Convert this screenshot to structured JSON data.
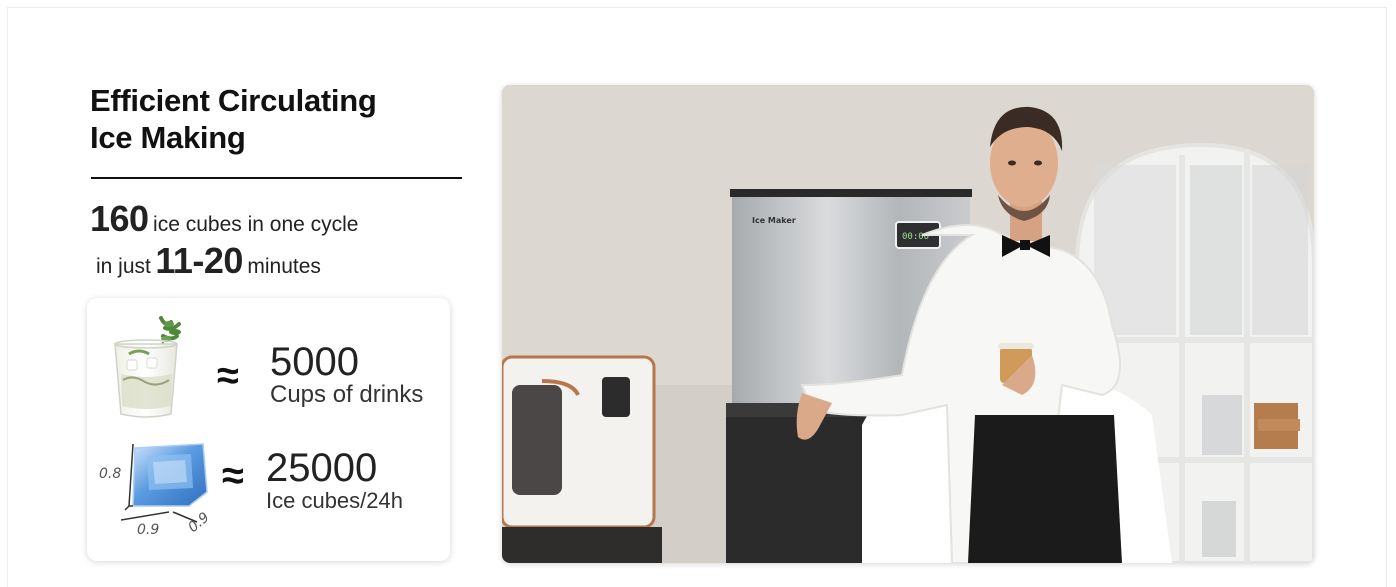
{
  "heading": {
    "line1": "Efficient Circulating",
    "line2": "Ice Making"
  },
  "stats": {
    "cubes_count": "160",
    "cubes_text": "ice cubes in one cycle",
    "in_just": "in just",
    "minutes_value": "11-20",
    "minutes_text": "minutes"
  },
  "card": {
    "drinks": {
      "approx": "≈",
      "value": "5000",
      "unit": "Cups of drinks",
      "icon": "cocktail-glass-icon"
    },
    "ice": {
      "approx": "≈",
      "value": "25000",
      "unit": "Ice cubes/24h",
      "icon": "ice-cube-icon",
      "dim_height": "0.8",
      "dim_width": "0.9",
      "dim_depth": "0.9"
    }
  },
  "photo": {
    "brand_label": "Ice Maker",
    "display_text": "00:00"
  },
  "colors": {
    "text": "#111111",
    "card_shadow": "#d6d6d6",
    "ice_blue": "#4f8fd6",
    "wall": "#ded9d3"
  }
}
